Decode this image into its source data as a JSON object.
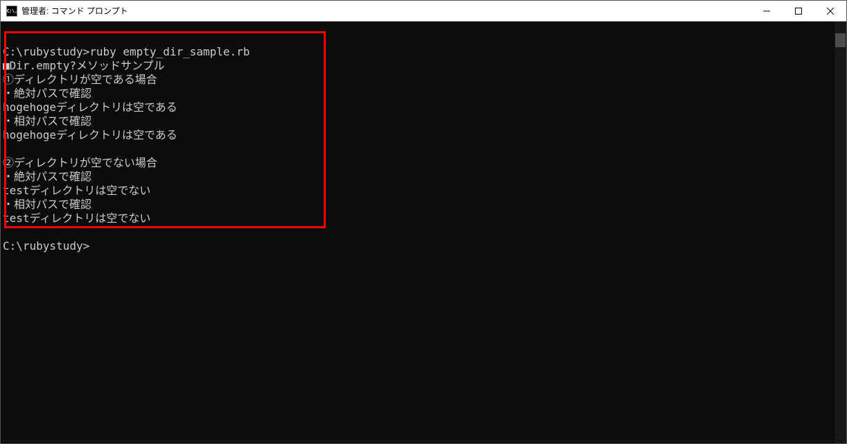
{
  "window": {
    "title": "管理者: コマンド プロンプト",
    "icon_text": "C:\\."
  },
  "terminal": {
    "lines": [
      "",
      "C:\\rubystudy>ruby empty_dir_sample.rb",
      "■Dir.empty?メソッドサンプル",
      "①ディレクトリが空である場合",
      "・絶対パスで確認",
      "hogehogeディレクトリは空である",
      "・相対パスで確認",
      "hogehogeディレクトリは空である",
      "",
      "②ディレクトリが空でない場合",
      "・絶対パスで確認",
      "testディレクトリは空でない",
      "・相対パスで確認",
      "testディレクトリは空でない",
      "",
      "C:\\rubystudy>"
    ]
  }
}
